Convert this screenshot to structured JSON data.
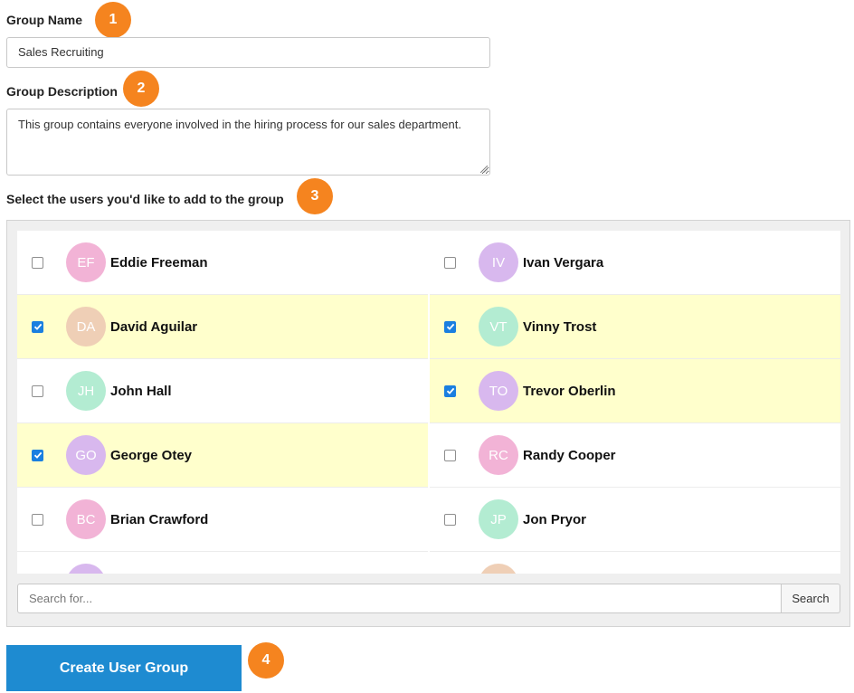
{
  "form": {
    "group_name_label": "Group Name",
    "group_name_value": "Sales Recruiting",
    "group_description_label": "Group Description",
    "group_description_value": "This group contains everyone involved in the hiring process for our sales department.",
    "select_users_label": "Select the users you'd like to add to the group",
    "search_placeholder": "Search for...",
    "search_button_label": "Search",
    "create_button_label": "Create User Group"
  },
  "step_badges": [
    "1",
    "2",
    "3",
    "4"
  ],
  "colors": {
    "badge": "#f5841f",
    "selected_row": "#ffffcc",
    "primary_button": "#1e8bd1",
    "checkbox_checked": "#1a7fe0"
  },
  "users": [
    {
      "initials": "EF",
      "name": "Eddie Freeman",
      "checked": false,
      "avatar_color": "#f2b3d6"
    },
    {
      "initials": "IV",
      "name": "Ivan Vergara",
      "checked": false,
      "avatar_color": "#d8b8ee"
    },
    {
      "initials": "DA",
      "name": "David Aguilar",
      "checked": true,
      "avatar_color": "#efcfb6"
    },
    {
      "initials": "VT",
      "name": "Vinny Trost",
      "checked": true,
      "avatar_color": "#b3ecd2"
    },
    {
      "initials": "JH",
      "name": "John Hall",
      "checked": false,
      "avatar_color": "#b3ecd2"
    },
    {
      "initials": "TO",
      "name": "Trevor Oberlin",
      "checked": true,
      "avatar_color": "#d8b8ee"
    },
    {
      "initials": "GO",
      "name": "George Otey",
      "checked": true,
      "avatar_color": "#d8b8ee"
    },
    {
      "initials": "RC",
      "name": "Randy Cooper",
      "checked": false,
      "avatar_color": "#f2b3d6"
    },
    {
      "initials": "BC",
      "name": "Brian Crawford",
      "checked": false,
      "avatar_color": "#f2b3d6"
    },
    {
      "initials": "JP",
      "name": "Jon Pryor",
      "checked": false,
      "avatar_color": "#b3ecd2"
    },
    {
      "initials": "",
      "name": "",
      "checked": false,
      "avatar_color": "#d8b8ee"
    },
    {
      "initials": "",
      "name": "",
      "checked": false,
      "avatar_color": "#efcfb6"
    }
  ]
}
